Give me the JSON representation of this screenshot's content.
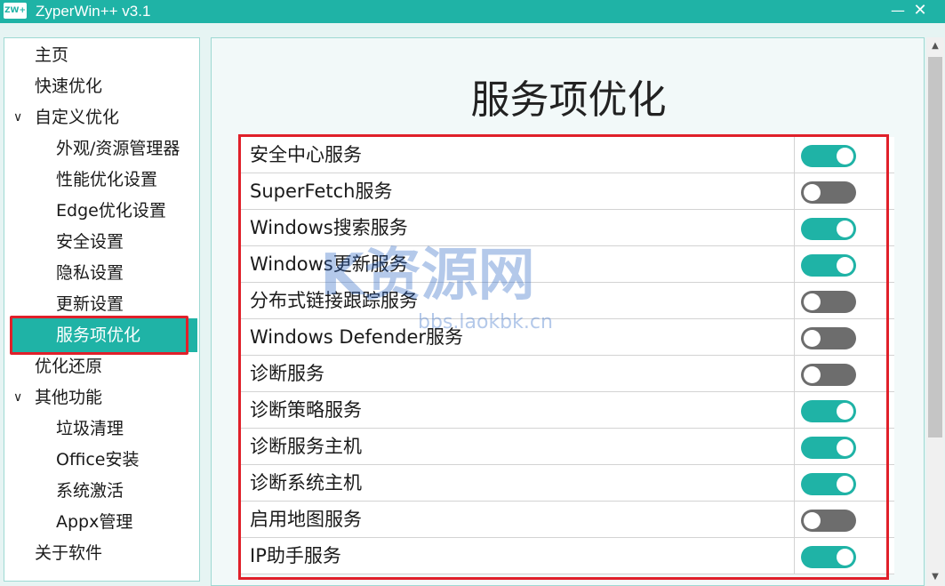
{
  "window": {
    "icon_text": "ZW+",
    "title": "ZyperWin++ v3.1",
    "minimize": "—",
    "close": "✕"
  },
  "sidebar": {
    "items": [
      {
        "label": "主页",
        "level": 0,
        "selected": false
      },
      {
        "label": "快速优化",
        "level": 0,
        "selected": false
      },
      {
        "label": "自定义优化",
        "level": 0,
        "expanded": true,
        "selected": false
      },
      {
        "label": "外观/资源管理器",
        "level": 1,
        "selected": false
      },
      {
        "label": "性能优化设置",
        "level": 1,
        "selected": false
      },
      {
        "label": "Edge优化设置",
        "level": 1,
        "selected": false
      },
      {
        "label": "安全设置",
        "level": 1,
        "selected": false
      },
      {
        "label": "隐私设置",
        "level": 1,
        "selected": false
      },
      {
        "label": "更新设置",
        "level": 1,
        "selected": false
      },
      {
        "label": "服务项优化",
        "level": 1,
        "selected": true
      },
      {
        "label": "优化还原",
        "level": 0,
        "selected": false
      },
      {
        "label": "其他功能",
        "level": 0,
        "expanded": true,
        "selected": false
      },
      {
        "label": "垃圾清理",
        "level": 1,
        "selected": false
      },
      {
        "label": "Office安装",
        "level": 1,
        "selected": false
      },
      {
        "label": "系统激活",
        "level": 1,
        "selected": false
      },
      {
        "label": "Appx管理",
        "level": 1,
        "selected": false
      },
      {
        "label": "关于软件",
        "level": 0,
        "selected": false
      }
    ],
    "chevron": "∨"
  },
  "main": {
    "title": "服务项优化",
    "services": [
      {
        "label": "安全中心服务",
        "enabled": true
      },
      {
        "label": "SuperFetch服务",
        "enabled": false
      },
      {
        "label": "Windows搜索服务",
        "enabled": true
      },
      {
        "label": "Windows更新服务",
        "enabled": true
      },
      {
        "label": "分布式链接跟踪服务",
        "enabled": false
      },
      {
        "label": "Windows Defender服务",
        "enabled": false
      },
      {
        "label": "诊断服务",
        "enabled": false
      },
      {
        "label": "诊断策略服务",
        "enabled": true
      },
      {
        "label": "诊断服务主机",
        "enabled": true
      },
      {
        "label": "诊断系统主机",
        "enabled": true
      },
      {
        "label": "启用地图服务",
        "enabled": false
      },
      {
        "label": "IP助手服务",
        "enabled": true
      }
    ]
  },
  "scrollbar": {
    "up_arrow": "▲",
    "down_arrow": "▼"
  },
  "watermark": {
    "main_text": "K资源网",
    "sub_text": "bbs.laokbk.cn"
  },
  "colors": {
    "accent": "#1fb3a6",
    "toggle_off": "#6d6d6d",
    "highlight_border": "#e0202a"
  }
}
